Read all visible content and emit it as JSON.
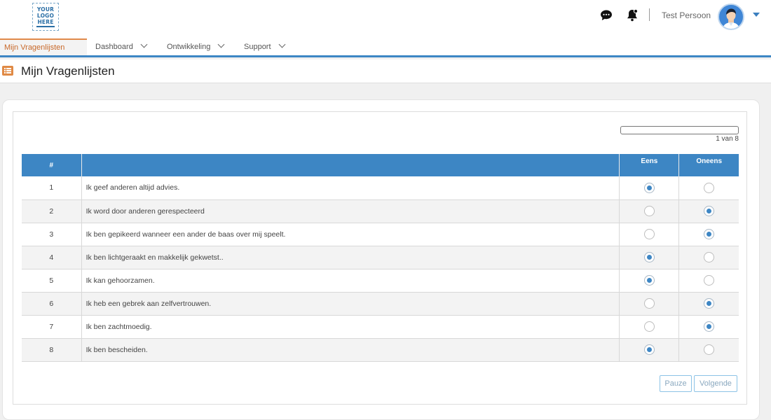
{
  "logo": {
    "line1": "YOUR",
    "line2": "LOGO",
    "line3": "HERE"
  },
  "header": {
    "icons": [
      "chat-icon",
      "bell-icon"
    ],
    "username": "Test Persoon"
  },
  "nav": {
    "items": [
      {
        "label": "Mijn Vragenlijsten",
        "active": true
      },
      {
        "label": "Dashboard",
        "dropdown": true
      },
      {
        "label": "Ontwikkeling",
        "dropdown": true
      },
      {
        "label": "Support",
        "dropdown": true
      }
    ]
  },
  "page": {
    "title": "Mijn Vragenlijsten",
    "icon": "list-icon"
  },
  "progress": {
    "text": "1 van 8",
    "fraction": 0.0
  },
  "table": {
    "headers": {
      "num": "#",
      "question": "",
      "opt1": "Eens",
      "opt2": "Oneens"
    },
    "rows": [
      {
        "num": "1",
        "question": "Ik geef anderen altijd advies.",
        "selected": "Eens"
      },
      {
        "num": "2",
        "question": "Ik word door anderen gerespecteerd",
        "selected": "Oneens"
      },
      {
        "num": "3",
        "question": "Ik ben gepikeerd wanneer een ander de baas over mij speelt.",
        "selected": "Oneens"
      },
      {
        "num": "4",
        "question": "Ik ben lichtgeraakt en makkelijk gekwetst..",
        "selected": "Eens"
      },
      {
        "num": "5",
        "question": "Ik kan gehoorzamen.",
        "selected": "Eens"
      },
      {
        "num": "6",
        "question": "Ik heb een gebrek aan zelfvertrouwen.",
        "selected": "Oneens"
      },
      {
        "num": "7",
        "question": "Ik ben zachtmoedig.",
        "selected": "Oneens"
      },
      {
        "num": "8",
        "question": "Ik ben bescheiden.",
        "selected": "Eens"
      }
    ]
  },
  "buttons": {
    "pause": "Pauze",
    "next": "Volgende"
  },
  "colors": {
    "primary": "#3d86c4",
    "accent": "#e0894a"
  }
}
